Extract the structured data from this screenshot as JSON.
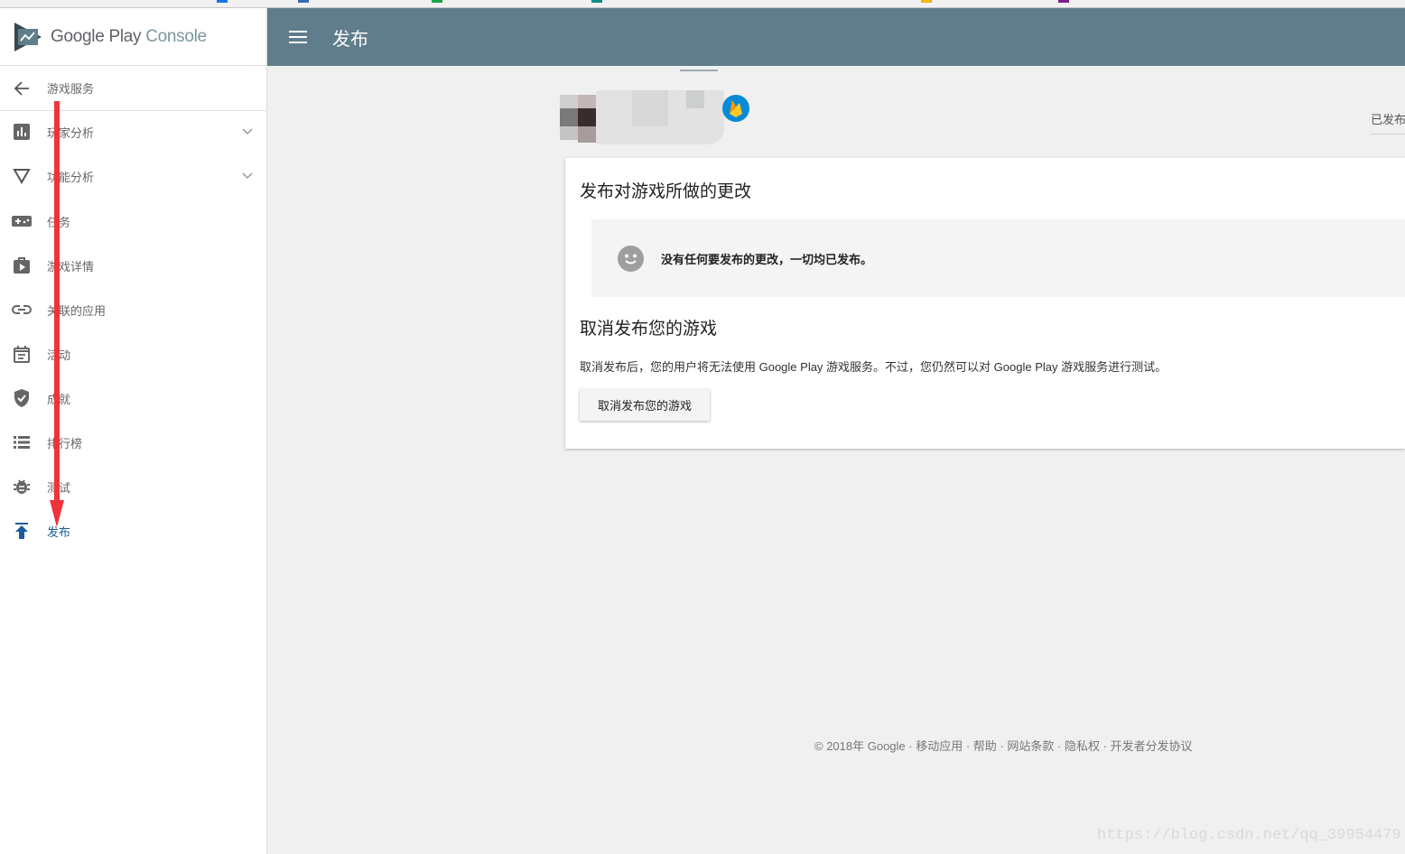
{
  "app": {
    "brand_primary": "Google Play",
    "brand_secondary": "Console"
  },
  "sidebar": {
    "back_label": "游戏服务",
    "items": [
      {
        "label": "玩家分析",
        "icon": "bar-chart-icon",
        "expandable": true
      },
      {
        "label": "功能分析",
        "icon": "funnel-icon",
        "expandable": true
      },
      {
        "label": "任务",
        "icon": "gamepad-icon",
        "expandable": false
      },
      {
        "label": "游戏详情",
        "icon": "play-bag-icon",
        "expandable": false
      },
      {
        "label": "关联的应用",
        "icon": "link-icon",
        "expandable": false
      },
      {
        "label": "活动",
        "icon": "calendar-icon",
        "expandable": false
      },
      {
        "label": "成就",
        "icon": "shield-check-icon",
        "expandable": false
      },
      {
        "label": "排行榜",
        "icon": "list-icon",
        "expandable": false
      },
      {
        "label": "测试",
        "icon": "bug-icon",
        "expandable": false
      },
      {
        "label": "发布",
        "icon": "publish-icon",
        "expandable": false,
        "active": true
      }
    ]
  },
  "topbar": {
    "title": "发布"
  },
  "game_header": {
    "status": "已发布"
  },
  "card": {
    "publish_heading": "发布对游戏所做的更改",
    "notice_text": "没有任何要发布的更改，一切均已发布。",
    "unpublish_heading": "取消发布您的游戏",
    "unpublish_description": "取消发布后，您的用户将无法使用 Google Play 游戏服务。不过，您仍然可以对 Google Play 游戏服务进行测试。",
    "unpublish_button": "取消发布您的游戏"
  },
  "footer": {
    "copyright": "© 2018年 Google",
    "separator": " · ",
    "links": [
      "移动应用",
      "帮助",
      "网站条款",
      "隐私权",
      "开发者分发协议"
    ]
  },
  "watermark": "https://blog.csdn.net/qq_39954479",
  "colors": {
    "topbar": "#607d8b",
    "active_nav": "#1a5c9a",
    "annotation_arrow": "#f0333a",
    "firebase_badge": "#0a8ad6"
  }
}
